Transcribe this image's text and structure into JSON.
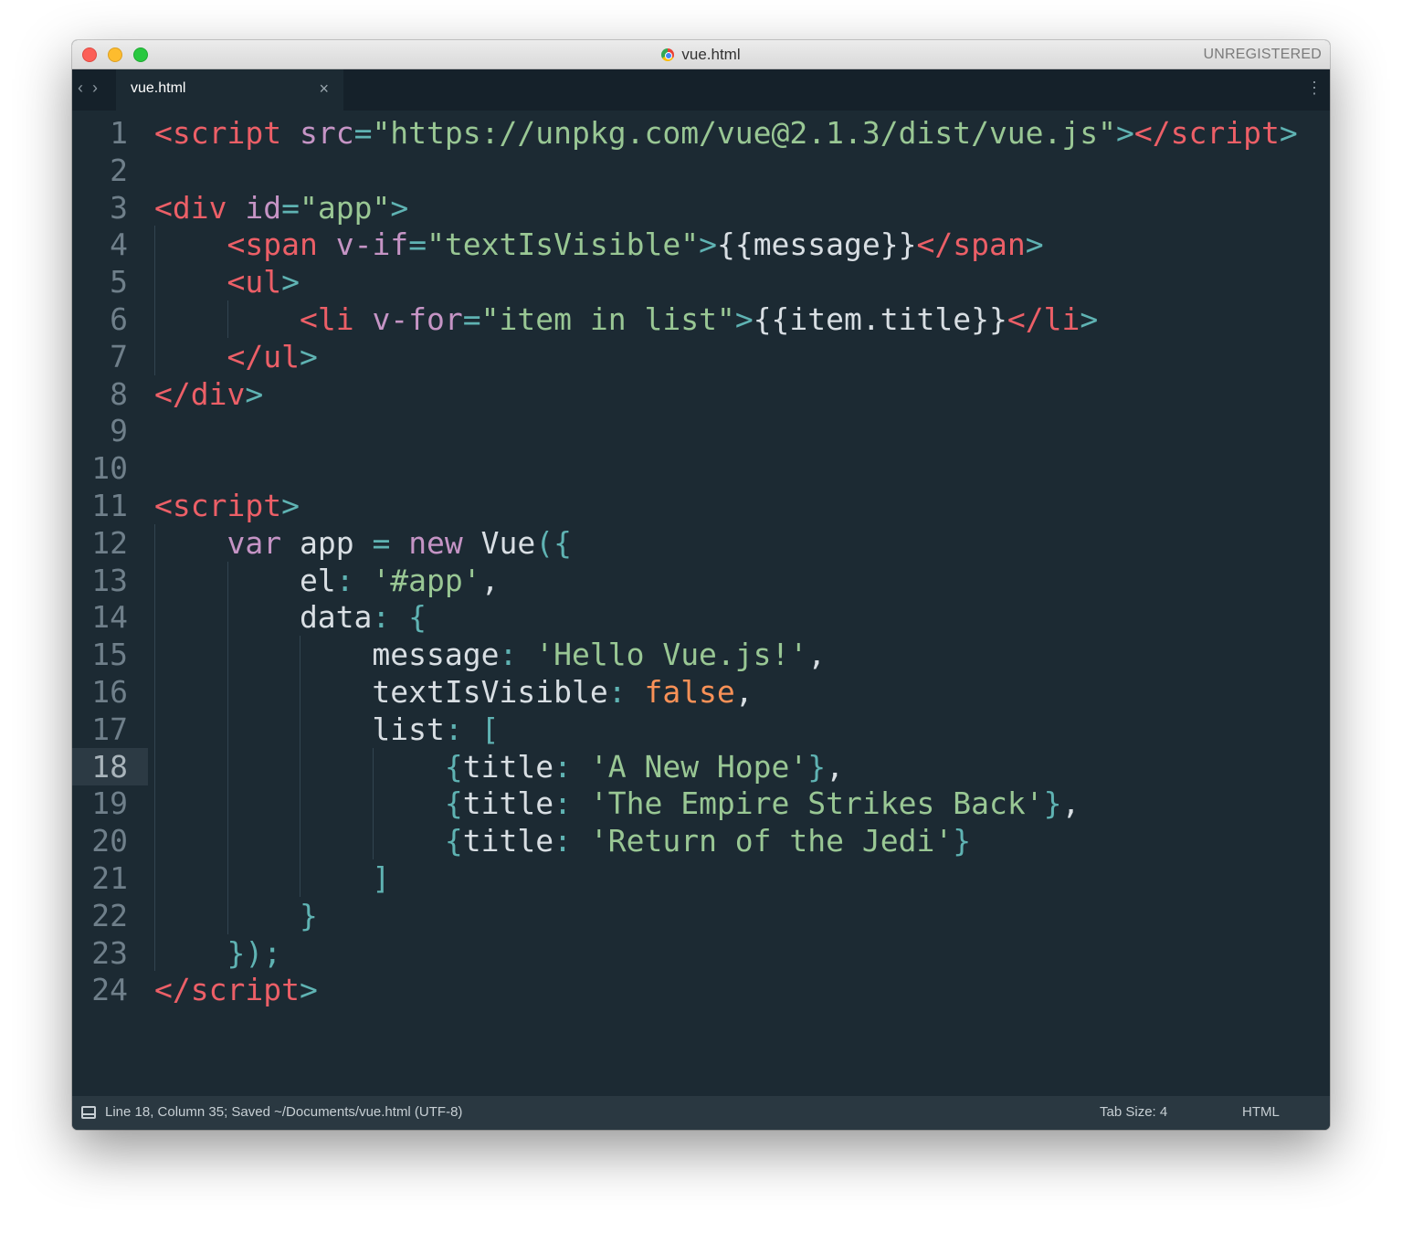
{
  "window": {
    "title": "vue.html",
    "title_icon": "chrome-file-icon",
    "unregistered_label": "UNREGISTERED"
  },
  "tabs": [
    {
      "label": "vue.html",
      "close_glyph": "×",
      "active": true
    }
  ],
  "tabbar": {
    "nav_back_glyph": "‹",
    "nav_forward_glyph": "›",
    "menu_glyph": "⋮"
  },
  "colors": {
    "background": "#1c2a33",
    "tag": "#ec5f67",
    "punctuation": "#5fb3b3",
    "attribute": "#c594c5",
    "string": "#99c794",
    "boolean": "#f99157",
    "text": "#d8dee3",
    "line_number": "#6f7f8a"
  },
  "editor": {
    "current_line": 18,
    "lines": [
      {
        "n": "1",
        "tokens": [
          [
            "tag",
            "<script"
          ],
          [
            "plain",
            " "
          ],
          [
            "attr",
            "src"
          ],
          [
            "punc",
            "="
          ],
          [
            "str",
            "\"https://unpkg.com/vue@2.1.3/dist/vue.js\""
          ],
          [
            "punc",
            ">"
          ],
          [
            "tag",
            "</script"
          ],
          [
            "punc",
            ">"
          ]
        ]
      },
      {
        "n": "2",
        "tokens": []
      },
      {
        "n": "3",
        "tokens": [
          [
            "tag",
            "<div"
          ],
          [
            "plain",
            " "
          ],
          [
            "attr",
            "id"
          ],
          [
            "punc",
            "="
          ],
          [
            "str",
            "\"app\""
          ],
          [
            "punc",
            ">"
          ]
        ]
      },
      {
        "n": "4",
        "tokens": [
          [
            "plain",
            "    "
          ],
          [
            "tag",
            "<span"
          ],
          [
            "plain",
            " "
          ],
          [
            "attr",
            "v-if"
          ],
          [
            "punc",
            "="
          ],
          [
            "str",
            "\"textIsVisible\""
          ],
          [
            "punc",
            ">"
          ],
          [
            "plain",
            "{{message}}"
          ],
          [
            "tag",
            "</span"
          ],
          [
            "punc",
            ">"
          ]
        ]
      },
      {
        "n": "5",
        "tokens": [
          [
            "plain",
            "    "
          ],
          [
            "tag",
            "<ul"
          ],
          [
            "punc",
            ">"
          ]
        ]
      },
      {
        "n": "6",
        "tokens": [
          [
            "plain",
            "        "
          ],
          [
            "tag",
            "<li"
          ],
          [
            "plain",
            " "
          ],
          [
            "attr",
            "v-for"
          ],
          [
            "punc",
            "="
          ],
          [
            "str",
            "\"item in list\""
          ],
          [
            "punc",
            ">"
          ],
          [
            "plain",
            "{{item.title}}"
          ],
          [
            "tag",
            "</li"
          ],
          [
            "punc",
            ">"
          ]
        ]
      },
      {
        "n": "7",
        "tokens": [
          [
            "plain",
            "    "
          ],
          [
            "tag",
            "</ul"
          ],
          [
            "punc",
            ">"
          ]
        ]
      },
      {
        "n": "8",
        "tokens": [
          [
            "tag",
            "</div"
          ],
          [
            "punc",
            ">"
          ]
        ]
      },
      {
        "n": "9",
        "tokens": []
      },
      {
        "n": "10",
        "tokens": []
      },
      {
        "n": "11",
        "tokens": [
          [
            "tag",
            "<script"
          ],
          [
            "punc",
            ">"
          ]
        ]
      },
      {
        "n": "12",
        "tokens": [
          [
            "plain",
            "    "
          ],
          [
            "kw",
            "var"
          ],
          [
            "plain",
            " app "
          ],
          [
            "op",
            "="
          ],
          [
            "plain",
            " "
          ],
          [
            "kw",
            "new"
          ],
          [
            "plain",
            " Vue"
          ],
          [
            "punc",
            "({"
          ]
        ]
      },
      {
        "n": "13",
        "tokens": [
          [
            "plain",
            "        el"
          ],
          [
            "punc",
            ":"
          ],
          [
            "plain",
            " "
          ],
          [
            "str",
            "'#app'"
          ],
          [
            "plain",
            ","
          ]
        ]
      },
      {
        "n": "14",
        "tokens": [
          [
            "plain",
            "        data"
          ],
          [
            "punc",
            ":"
          ],
          [
            "plain",
            " "
          ],
          [
            "punc",
            "{"
          ]
        ]
      },
      {
        "n": "15",
        "tokens": [
          [
            "plain",
            "            message"
          ],
          [
            "punc",
            ":"
          ],
          [
            "plain",
            " "
          ],
          [
            "str",
            "'Hello Vue.js!'"
          ],
          [
            "plain",
            ","
          ]
        ]
      },
      {
        "n": "16",
        "tokens": [
          [
            "plain",
            "            textIsVisible"
          ],
          [
            "punc",
            ":"
          ],
          [
            "plain",
            " "
          ],
          [
            "bool",
            "false"
          ],
          [
            "plain",
            ","
          ]
        ]
      },
      {
        "n": "17",
        "tokens": [
          [
            "plain",
            "            list"
          ],
          [
            "punc",
            ":"
          ],
          [
            "plain",
            " "
          ],
          [
            "punc",
            "["
          ]
        ]
      },
      {
        "n": "18",
        "tokens": [
          [
            "plain",
            "                "
          ],
          [
            "punc",
            "{"
          ],
          [
            "plain",
            "title"
          ],
          [
            "punc",
            ":"
          ],
          [
            "plain",
            " "
          ],
          [
            "str",
            "'A New Hope'"
          ],
          [
            "punc",
            "}"
          ],
          [
            "plain",
            ","
          ]
        ]
      },
      {
        "n": "19",
        "tokens": [
          [
            "plain",
            "                "
          ],
          [
            "punc",
            "{"
          ],
          [
            "plain",
            "title"
          ],
          [
            "punc",
            ":"
          ],
          [
            "plain",
            " "
          ],
          [
            "str",
            "'The Empire Strikes Back'"
          ],
          [
            "punc",
            "}"
          ],
          [
            "plain",
            ","
          ]
        ]
      },
      {
        "n": "20",
        "tokens": [
          [
            "plain",
            "                "
          ],
          [
            "punc",
            "{"
          ],
          [
            "plain",
            "title"
          ],
          [
            "punc",
            ":"
          ],
          [
            "plain",
            " "
          ],
          [
            "str",
            "'Return of the Jedi'"
          ],
          [
            "punc",
            "}"
          ]
        ]
      },
      {
        "n": "21",
        "tokens": [
          [
            "plain",
            "            "
          ],
          [
            "punc",
            "]"
          ]
        ]
      },
      {
        "n": "22",
        "tokens": [
          [
            "plain",
            "        "
          ],
          [
            "punc",
            "}"
          ]
        ]
      },
      {
        "n": "23",
        "tokens": [
          [
            "plain",
            "    "
          ],
          [
            "punc",
            "});"
          ]
        ]
      },
      {
        "n": "24",
        "tokens": [
          [
            "tag",
            "</script"
          ],
          [
            "punc",
            ">"
          ]
        ]
      }
    ]
  },
  "statusbar": {
    "position_text": "Line 18, Column 35; Saved ~/Documents/vue.html (UTF-8)",
    "tab_size": "Tab Size: 4",
    "syntax": "HTML"
  }
}
